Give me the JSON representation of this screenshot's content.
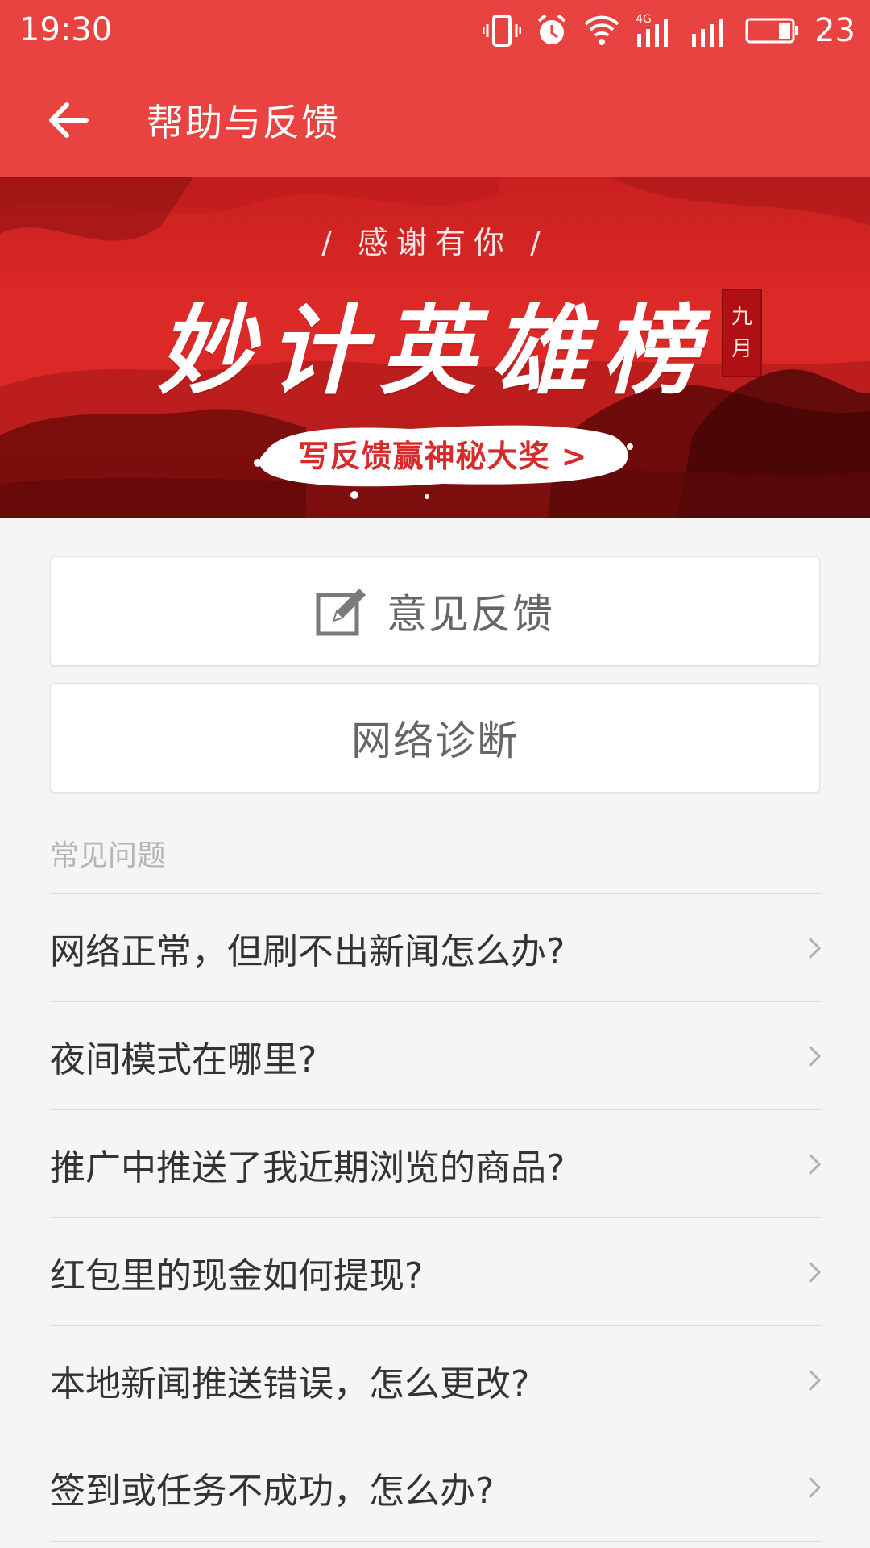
{
  "status_bar": {
    "time": "19:30",
    "network_label": "4G",
    "battery_percent": "23"
  },
  "app_bar": {
    "title": "帮助与反馈",
    "back_icon": "arrow-left-icon"
  },
  "banner": {
    "subtitle": "/ 感谢有你 /",
    "title": "妙计英雄榜",
    "seal_line1": "九",
    "seal_line2": "月",
    "cta": "写反馈赢神秘大奖 >"
  },
  "actions": {
    "feedback_label": "意见反馈",
    "feedback_icon": "edit-icon",
    "diagnose_label": "网络诊断"
  },
  "faq": {
    "header": "常见问题",
    "items": [
      {
        "label": "网络正常，但刷不出新闻怎么办?"
      },
      {
        "label": "夜间模式在哪里?"
      },
      {
        "label": "推广中推送了我近期浏览的商品?"
      },
      {
        "label": "红包里的现金如何提现?"
      },
      {
        "label": "本地新闻推送错误，怎么更改?"
      },
      {
        "label": "签到或任务不成功，怎么办?"
      }
    ]
  },
  "colors": {
    "primary": "#e84340",
    "background": "#f5f5f5",
    "text": "#333333",
    "muted": "#b5b5b5"
  }
}
